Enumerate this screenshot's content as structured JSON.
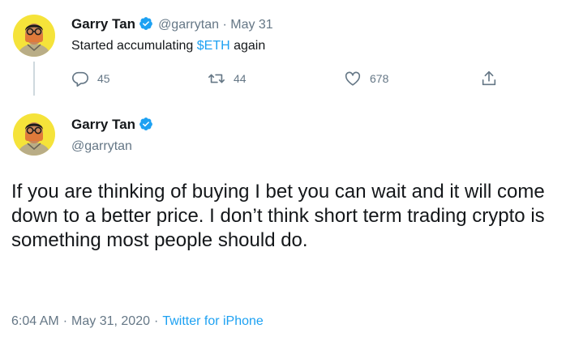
{
  "colors": {
    "text": "#14171a",
    "muted": "#657786",
    "link": "#1da1f2",
    "line": "#cfd9de"
  },
  "reply_tweet": {
    "author": {
      "name": "Garry Tan",
      "handle": "@garrytan",
      "verified": true,
      "avatar_icon": "avatar-illustration"
    },
    "separator": "·",
    "date": "May 31",
    "text_before": "Started accumulating ",
    "cashtag": "$ETH",
    "text_after": " again",
    "actions": {
      "replies": {
        "icon": "reply-icon",
        "count": "45"
      },
      "retweets": {
        "icon": "retweet-icon",
        "count": "44"
      },
      "likes": {
        "icon": "heart-icon",
        "count": "678"
      },
      "share": {
        "icon": "share-icon"
      }
    }
  },
  "main_tweet": {
    "author": {
      "name": "Garry Tan",
      "handle": "@garrytan",
      "verified": true,
      "avatar_icon": "avatar-illustration"
    },
    "text": "If you are thinking of buying I bet you can wait and it will come down to a better price. I don’t think short term trading crypto is something most people should do.",
    "time": "6:04 AM",
    "separator": "·",
    "date": "May 31, 2020",
    "source": "Twitter for iPhone"
  }
}
